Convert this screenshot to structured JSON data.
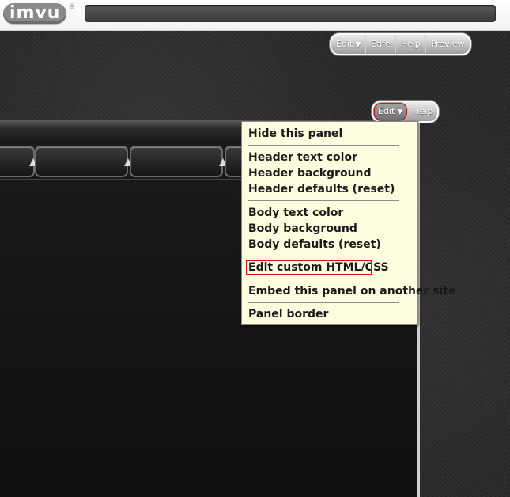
{
  "brand": {
    "logo_text": "imvu",
    "reg_mark": "®"
  },
  "page_toolbar": {
    "items": [
      {
        "label": "Edit",
        "caret": "▼"
      },
      {
        "label": "Safe"
      },
      {
        "label": "Help"
      },
      {
        "label": "Preview"
      }
    ]
  },
  "panel_toolbar": {
    "items": [
      {
        "label": "Edit",
        "caret": "▼"
      },
      {
        "label": "Help"
      }
    ]
  },
  "edit_menu": {
    "items": [
      "Hide this panel",
      "Header text color",
      "Header background",
      "Header defaults (reset)",
      "Body text color",
      "Body background",
      "Body defaults (reset)",
      "Edit custom HTML/CSS",
      "Embed this panel on another site",
      "Panel border"
    ],
    "highlighted_item": "Edit custom HTML/CSS"
  },
  "colors": {
    "menu_background": "#fffde0",
    "highlight_outline": "#e01010",
    "page_background": "#2b2b2b"
  }
}
